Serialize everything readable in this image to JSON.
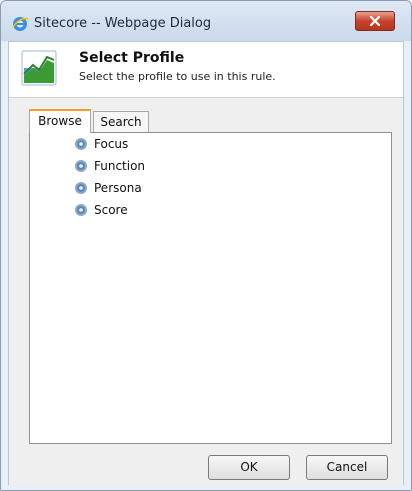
{
  "window": {
    "title": "Sitecore -- Webpage Dialog"
  },
  "header": {
    "title": "Select Profile",
    "subtitle": "Select the profile to use in this rule."
  },
  "tabs": [
    {
      "label": "Browse",
      "active": true
    },
    {
      "label": "Search",
      "active": false
    }
  ],
  "tree": {
    "items": [
      {
        "label": "Focus",
        "icon": "gear-icon"
      },
      {
        "label": "Function",
        "icon": "gear-icon"
      },
      {
        "label": "Persona",
        "icon": "gear-icon"
      },
      {
        "label": "Score",
        "icon": "gear-icon"
      }
    ]
  },
  "buttons": {
    "ok": "OK",
    "cancel": "Cancel"
  },
  "colors": {
    "accent_tab": "#f0a030",
    "close_button": "#c8432c"
  }
}
